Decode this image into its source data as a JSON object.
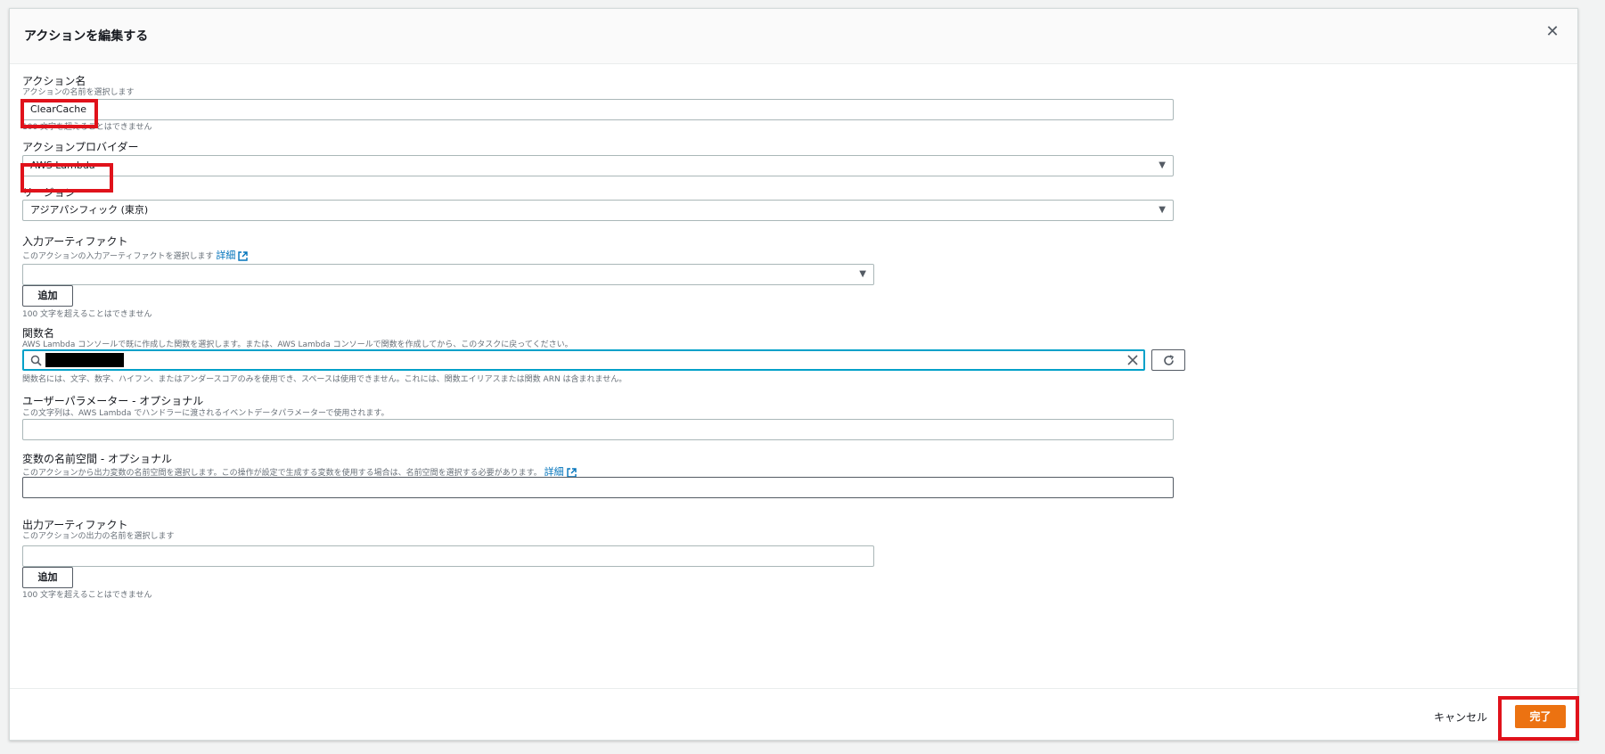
{
  "modal": {
    "title": "アクションを編集する",
    "close": "✕"
  },
  "action_name": {
    "label": "アクション名",
    "description": "アクションの名前を選択します",
    "value": "ClearCache",
    "constraint": "100 文字を超えることはできません"
  },
  "action_provider": {
    "label": "アクションプロバイダー",
    "value": "AWS Lambda"
  },
  "region": {
    "label": "リージョン",
    "value": "アジアパシフィック (東京)"
  },
  "input_artifacts": {
    "label": "入力アーティファクト",
    "description": "このアクションの入力アーティファクトを選択します",
    "link": "詳細",
    "value": "",
    "add_button": "追加",
    "constraint": "100 文字を超えることはできません"
  },
  "function_name": {
    "label": "関数名",
    "description": "AWS Lambda コンソールで既に作成した関数を選択します。または、AWS Lambda コンソールで関数を作成してから、このタスクに戻ってください。",
    "constraint": "関数名には、文字、数字、ハイフン、またはアンダースコアのみを使用でき、スペースは使用できません。これには、関数エイリアスまたは関数 ARN は含まれません。"
  },
  "user_parameters": {
    "label": "ユーザーパラメーター - オプショナル",
    "description": "この文字列は、AWS Lambda でハンドラーに渡されるイベントデータパラメーターで使用されます。",
    "value": ""
  },
  "variable_namespace": {
    "label": "変数の名前空間 - オプショナル",
    "description": "このアクションから出力変数の名前空間を選択します。この操作が設定で生成する変数を使用する場合は、名前空間を選択する必要があります。",
    "link": "詳細",
    "value": ""
  },
  "output_artifacts": {
    "label": "出力アーティファクト",
    "description": "このアクションの出力の名前を選択します",
    "value": "",
    "add_button": "追加",
    "constraint": "100 文字を超えることはできません"
  },
  "footer": {
    "cancel": "キャンセル",
    "done": "完了"
  },
  "colors": {
    "primary": "#ec7211",
    "link": "#0073bb",
    "highlight": "#e0121b",
    "focus": "#00a1c9"
  }
}
